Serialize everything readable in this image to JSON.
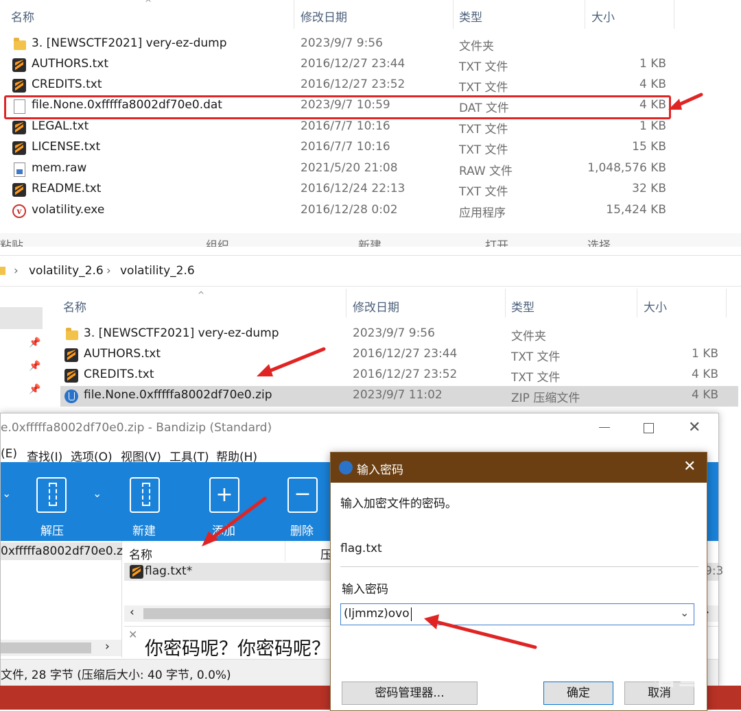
{
  "top_explorer": {
    "columns": {
      "name": "名称",
      "date": "修改日期",
      "type": "类型",
      "size": "大小"
    },
    "rows": [
      {
        "icon": "folder-icon",
        "name": "3. [NEWSCTF2021] very-ez-dump",
        "date": "2023/9/7 9:56",
        "type": "文件夹",
        "size": ""
      },
      {
        "icon": "sublime-file-icon",
        "name": "AUTHORS.txt",
        "date": "2016/12/27 23:44",
        "type": "TXT 文件",
        "size": "1 KB"
      },
      {
        "icon": "sublime-file-icon",
        "name": "CREDITS.txt",
        "date": "2016/12/27 23:52",
        "type": "TXT 文件",
        "size": "4 KB"
      },
      {
        "icon": "blank-file-icon",
        "name": "file.None.0xfffffa8002df70e0.dat",
        "date": "2023/9/7 10:59",
        "type": "DAT 文件",
        "size": "4 KB"
      },
      {
        "icon": "sublime-file-icon",
        "name": "LEGAL.txt",
        "date": "2016/7/7 10:16",
        "type": "TXT 文件",
        "size": "1 KB"
      },
      {
        "icon": "sublime-file-icon",
        "name": "LICENSE.txt",
        "date": "2016/7/7 10:16",
        "type": "TXT 文件",
        "size": "15 KB"
      },
      {
        "icon": "raw-file-icon",
        "name": "mem.raw",
        "date": "2021/5/20 21:08",
        "type": "RAW 文件",
        "size": "1,048,576 KB"
      },
      {
        "icon": "sublime-file-icon",
        "name": "README.txt",
        "date": "2016/12/24 22:13",
        "type": "TXT 文件",
        "size": "32 KB"
      },
      {
        "icon": "volatility-icon",
        "name": "volatility.exe",
        "date": "2016/12/28 0:02",
        "type": "应用程序",
        "size": "15,424 KB"
      }
    ],
    "bottom_strip": [
      "粘贴",
      "组织",
      "新建",
      "打开",
      "选择"
    ]
  },
  "bottom_explorer": {
    "breadcrumb": [
      "volatility_2.6",
      "volatility_2.6"
    ],
    "columns": {
      "name": "名称",
      "date": "修改日期",
      "type": "类型",
      "size": "大小"
    },
    "rows": [
      {
        "icon": "folder-icon",
        "name": "3. [NEWSCTF2021] very-ez-dump",
        "date": "2023/9/7 9:56",
        "type": "文件夹",
        "size": ""
      },
      {
        "icon": "sublime-file-icon",
        "name": "AUTHORS.txt",
        "date": "2016/12/27 23:44",
        "type": "TXT 文件",
        "size": "1 KB"
      },
      {
        "icon": "sublime-file-icon",
        "name": "CREDITS.txt",
        "date": "2016/12/27 23:52",
        "type": "TXT 文件",
        "size": "4 KB"
      },
      {
        "icon": "zip-file-icon",
        "name": "file.None.0xfffffa8002df70e0.zip",
        "date": "2023/9/7 11:02",
        "type": "ZIP 压缩文件",
        "size": "4 KB"
      }
    ]
  },
  "bandizip": {
    "title": "e.0xfffffa8002df70e0.zip - Bandizip (Standard)",
    "menu": [
      "(E)",
      "查找(I)",
      "选项(O)",
      "视图(V)",
      "工具(T)",
      "帮助(H)"
    ],
    "toolbar": [
      "解压",
      "新建",
      "添加",
      "删除"
    ],
    "tree_item": "0xfffffa8002df70e0.z",
    "list_header": {
      "name": "名称",
      "packed": "压"
    },
    "list_items": [
      {
        "name": "flag.txt*"
      }
    ],
    "comment": "你密码呢？你密码呢？",
    "status": "文件, 28 字节 (压缩后大小: 40 字节, 0.0%)",
    "right_time": "9:3"
  },
  "password_dialog": {
    "title": "输入密码",
    "prompt": "输入加密文件的密码。",
    "filename": "flag.txt",
    "label": "输入密码",
    "value": "(ljmmz)ovo",
    "manager_button": "密码管理器...",
    "ok_button": "确定",
    "cancel_button": "取消"
  },
  "watermark": "看雪",
  "colors": {
    "highlight_red": "#e02424",
    "bandizip_blue": "#1a82d8",
    "dialog_brown": "#6b3f12",
    "selected_row": "#d9d9d9",
    "taskbar_red": "#b83226"
  }
}
